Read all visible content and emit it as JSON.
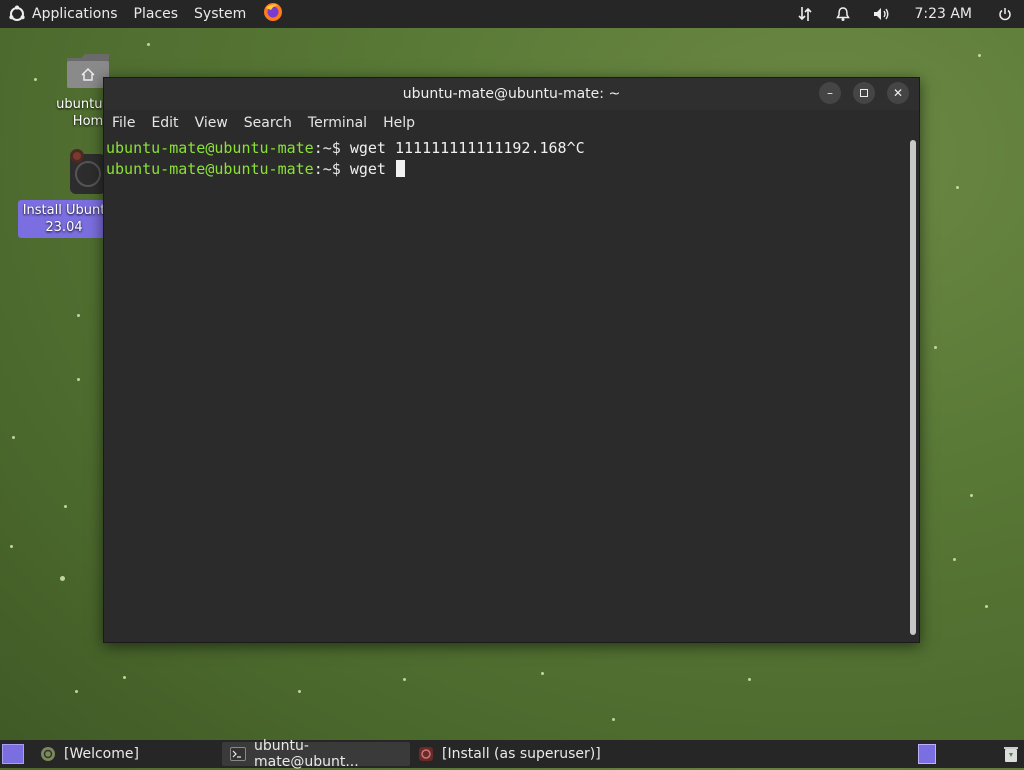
{
  "top_panel": {
    "menus": [
      "Applications",
      "Places",
      "System"
    ],
    "clock": "7:23 AM"
  },
  "desktop": {
    "home_label_line1": "ubuntu-m",
    "home_label_line2": "Hom",
    "install_label_line1": "Install Ubunt",
    "install_label_line2": "23.04"
  },
  "terminal": {
    "title": "ubuntu-mate@ubuntu-mate: ~",
    "menu": [
      "File",
      "Edit",
      "View",
      "Search",
      "Terminal",
      "Help"
    ],
    "lines": [
      {
        "user": "ubuntu-mate@ubuntu-mate",
        "sep": ":~$",
        "cmd": " wget 111111111111192.168^C"
      },
      {
        "user": "ubuntu-mate@ubuntu-mate",
        "sep": ":~$",
        "cmd": " wget "
      }
    ]
  },
  "taskbar": {
    "welcome": "[Welcome]",
    "terminal": "ubuntu-mate@ubunt...",
    "install": "[Install (as superuser)]"
  },
  "colors": {
    "prompt_user": "#8ae234",
    "accent": "#7b6ee0",
    "panel": "#262626"
  }
}
